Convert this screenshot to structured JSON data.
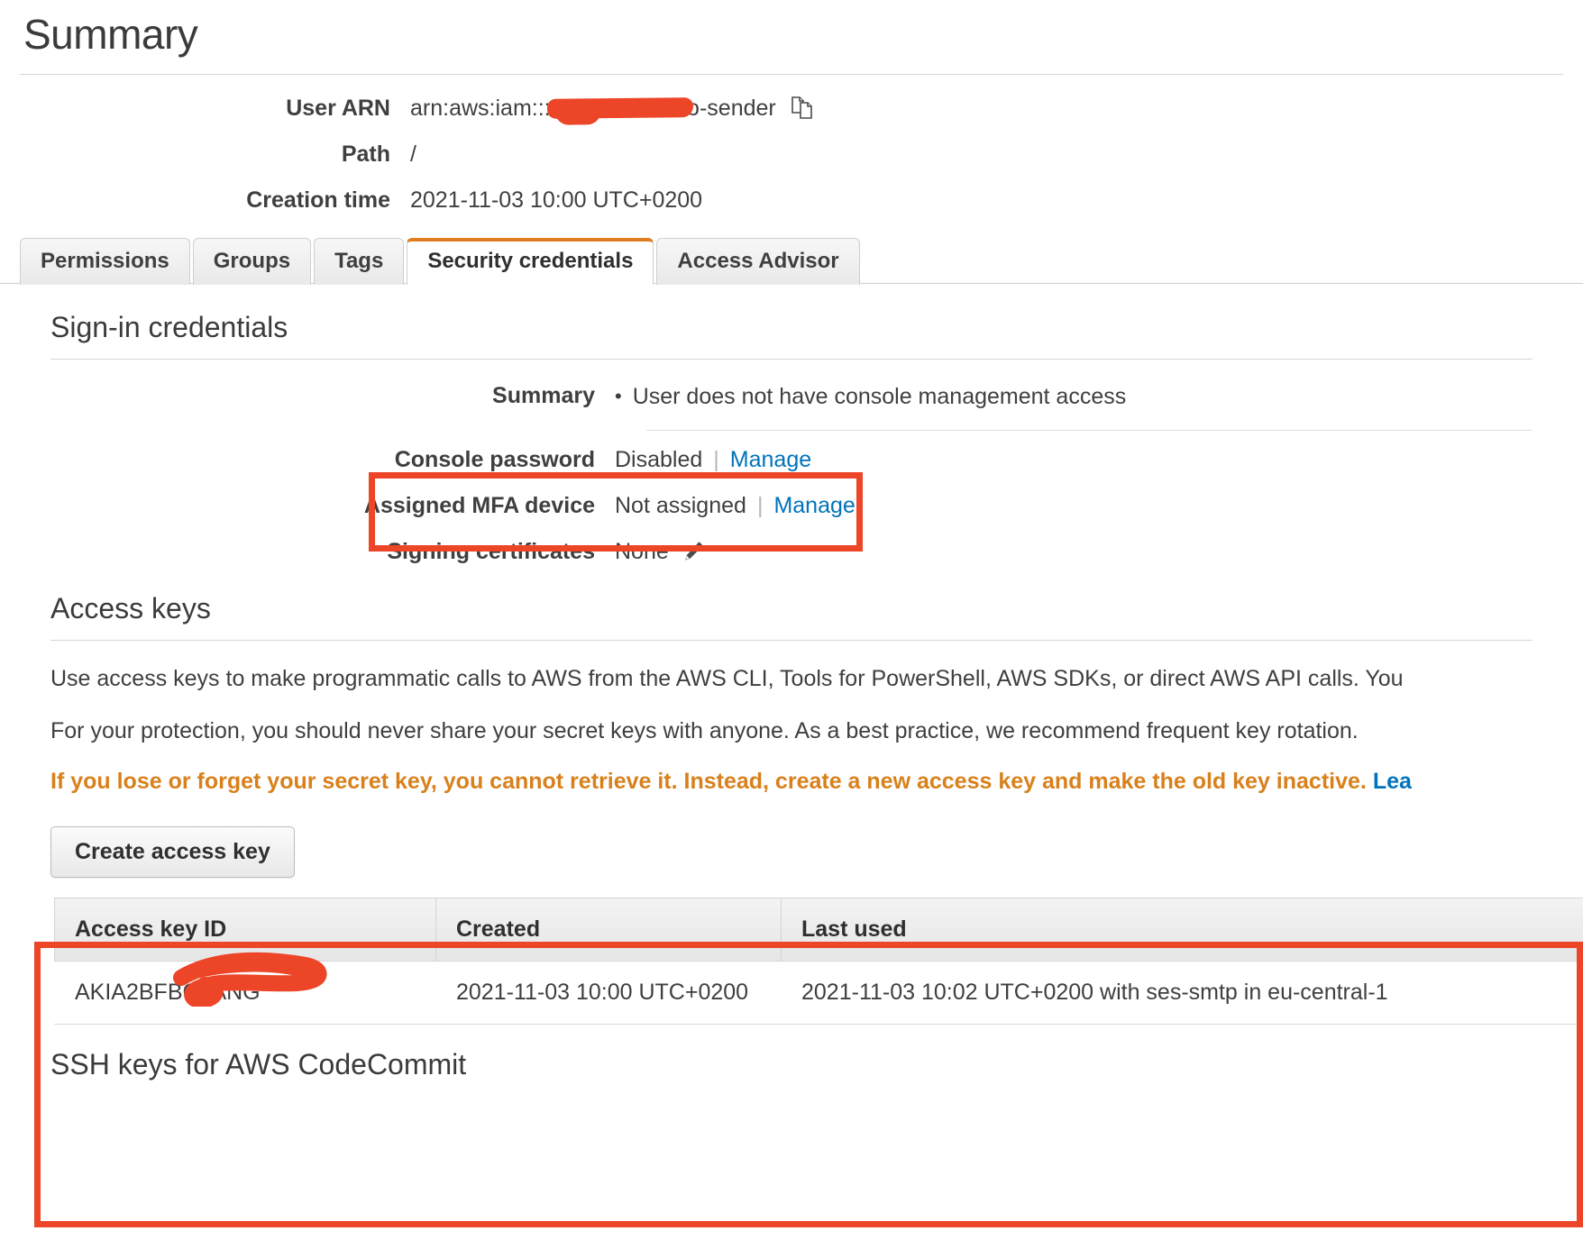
{
  "page": {
    "title": "Summary"
  },
  "summary": {
    "rows": [
      {
        "label": "User ARN",
        "value_prefix": "arn:aws:iam::",
        "value_suffix": ":user/ses-demo-sender",
        "redacted": true,
        "copy_icon": "copy-icon"
      },
      {
        "label": "Path",
        "value": "/"
      },
      {
        "label": "Creation time",
        "value": "2021-11-03 10:00 UTC+0200"
      }
    ]
  },
  "tabs": [
    {
      "label": "Permissions",
      "active": false
    },
    {
      "label": "Groups",
      "active": false
    },
    {
      "label": "Tags",
      "active": false
    },
    {
      "label": "Security credentials",
      "active": true
    },
    {
      "label": "Access Advisor",
      "active": false
    }
  ],
  "signin": {
    "heading": "Sign-in credentials",
    "summary_label": "Summary",
    "summary_value": "User does not have console management access",
    "console_password": {
      "label": "Console password",
      "value": "Disabled",
      "separator": "|",
      "action": "Manage"
    },
    "mfa": {
      "label": "Assigned MFA device",
      "value": "Not assigned",
      "separator": "|",
      "action": "Manage"
    },
    "signing_certificates": {
      "label": "Signing certificates",
      "value": "None",
      "edit_icon": "pencil-icon"
    }
  },
  "access_keys": {
    "heading": "Access keys",
    "description": "Use access keys to make programmatic calls to AWS from the AWS CLI, Tools for PowerShell, AWS SDKs, or direct AWS API calls. You",
    "protection_note": "For your protection, you should never share your secret keys with anyone. As a best practice, we recommend frequent key rotation.",
    "warning": "If you lose or forget your secret key, you cannot retrieve it. Instead, create a new access key and make the old key inactive.",
    "warning_link": "Lea",
    "create_button": "Create access key",
    "table": {
      "columns": [
        "Access key ID",
        "Created",
        "Last used"
      ],
      "rows": [
        {
          "access_key_id_prefix": "AKIA2BFBC5",
          "access_key_id_suffix": "ANG",
          "redacted": true,
          "created": "2021-11-03 10:00 UTC+0200",
          "last_used": "2021-11-03 10:02 UTC+0200 with ses-smtp in eu-central-1"
        }
      ]
    }
  },
  "footer_partial": "SSH keys for AWS CodeCommit",
  "colors": {
    "annotation": "#ec4527",
    "active_tab_border": "#e07c24",
    "link": "#0073bb",
    "warning_text": "#d8811c"
  }
}
